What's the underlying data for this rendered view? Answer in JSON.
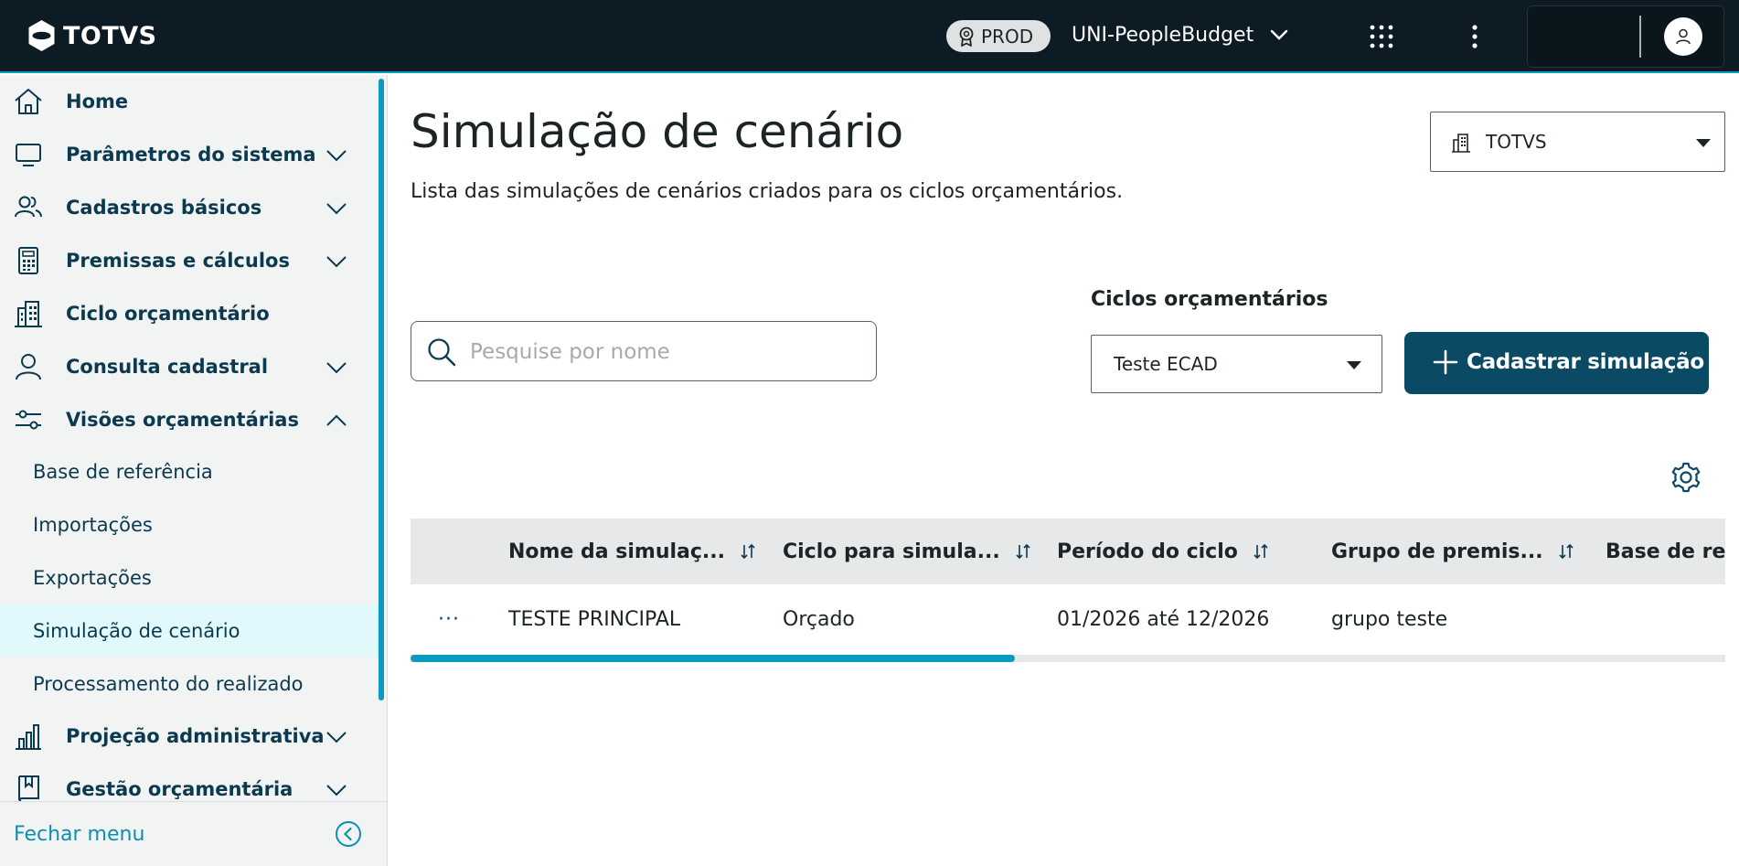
{
  "topbar": {
    "brand": "TOTVS",
    "environment_badge": "PROD",
    "app_name": "UNI-PeopleBudget"
  },
  "sidebar": {
    "items": [
      {
        "label": "Home",
        "icon": "home-icon"
      },
      {
        "label": "Parâmetros do sistema",
        "icon": "monitor-icon"
      },
      {
        "label": "Cadastros básicos",
        "icon": "users-icon"
      },
      {
        "label": "Premissas e cálculos",
        "icon": "calculator-icon"
      },
      {
        "label": "Ciclo orçamentário",
        "icon": "building-icon"
      },
      {
        "label": "Consulta cadastral",
        "icon": "user-icon"
      },
      {
        "label": "Visões orçamentárias",
        "icon": "sliders-icon"
      },
      {
        "label": "Projeção administrativa",
        "icon": "bar-chart-icon"
      },
      {
        "label": "Gestão orçamentária",
        "icon": "book-icon"
      }
    ],
    "subitems": [
      {
        "label": "Base de referência"
      },
      {
        "label": "Importações"
      },
      {
        "label": "Exportações"
      },
      {
        "label": "Simulação de cenário",
        "active": true
      },
      {
        "label": "Processamento do realizado"
      }
    ],
    "close_menu": "Fechar menu"
  },
  "main": {
    "title": "Simulação de cenário",
    "subtitle": "Lista das simulações de cenários criados para os ciclos orçamentários.",
    "company_select": "TOTVS",
    "search_placeholder": "Pesquise por nome",
    "cycles_label": "Ciclos orçamentários",
    "cycles_value": "Teste ECAD",
    "add_button": "Cadastrar simulação"
  },
  "table": {
    "columns": [
      "Nome da simulaç...",
      "Ciclo para simula...",
      "Período do ciclo",
      "Grupo de premis...",
      "Base de referência"
    ],
    "rows": [
      {
        "menu": "···",
        "cells": [
          "TESTE PRINCIPAL",
          "Orçado",
          "01/2026 até 12/2026",
          "grupo teste",
          ""
        ]
      }
    ],
    "scroll_fraction": 0.46
  },
  "colors": {
    "topbar_bg": "#0c1b24",
    "accent": "#0c9abe",
    "primary_button": "#0b4a64",
    "sidebar_text": "#0b3a4f",
    "active_item_bg": "#e1f8fc"
  }
}
